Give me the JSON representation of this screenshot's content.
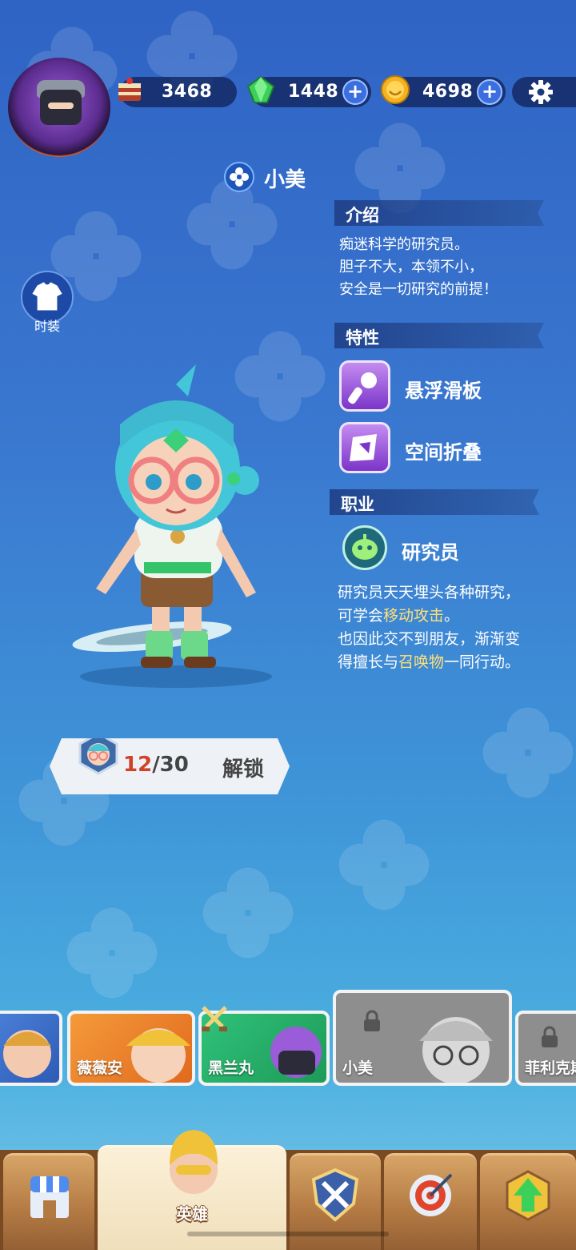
{
  "top_bar": {
    "resources": [
      {
        "icon": "cake-icon",
        "value": "3468"
      },
      {
        "icon": "green-gem-icon",
        "value": "1448"
      },
      {
        "icon": "gold-coin-icon",
        "value": "4698"
      }
    ]
  },
  "hero": {
    "name": "小美",
    "costume_label": "时装"
  },
  "intro": {
    "heading": "介绍",
    "lines": [
      "痴迷科学的研究员。",
      "胆子不大，本领不小，",
      "安全是一切研究的前提！"
    ]
  },
  "traits": {
    "heading": "特性",
    "items": [
      {
        "label": "悬浮滑板",
        "icon": "hoverboard-icon"
      },
      {
        "label": "空间折叠",
        "icon": "space-fold-icon"
      }
    ]
  },
  "job": {
    "heading": "职业",
    "name": "研究员",
    "icon": "robot-icon",
    "line1": "研究员天天埋头各种研究，",
    "line2_pre": "可学会",
    "line2_hl": "移动攻击",
    "line2_post": "。",
    "line3": "也因此交不到朋友，渐渐变",
    "line4_pre": "得擅长与",
    "line4_hl": "召唤物",
    "line4_post": "一同行动。"
  },
  "unlock": {
    "current": "12",
    "total": "/30",
    "label": "解锁"
  },
  "roster": [
    {
      "name": "",
      "color": "#3a7bd5",
      "locked": false
    },
    {
      "name": "薇薇安",
      "color": "#f07a2a",
      "locked": false
    },
    {
      "name": "黑兰丸",
      "color": "#2fb26a",
      "locked": false
    },
    {
      "name": "小美",
      "color": "#9a9a9a",
      "locked": true
    },
    {
      "name": "菲利克斯",
      "color": "#9a9a9a",
      "locked": true
    }
  ],
  "nav": {
    "items": [
      {
        "icon": "shop-icon",
        "label": ""
      },
      {
        "icon": "hero-icon",
        "label": "英雄"
      },
      {
        "icon": "battle-icon",
        "label": ""
      },
      {
        "icon": "target-icon",
        "label": ""
      },
      {
        "icon": "upgrade-icon",
        "label": ""
      }
    ]
  },
  "colors": {
    "accent_highlight": "#ffe07a",
    "unlock_count": "#d0432a"
  }
}
